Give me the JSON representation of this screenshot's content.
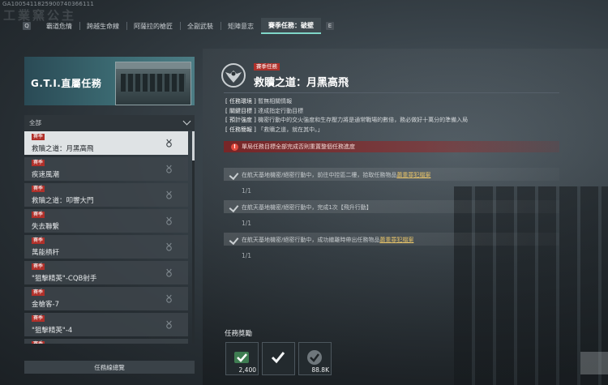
{
  "watermark": "GA1005411825900740366111",
  "ghost_title": "工業窯公主",
  "tabs": {
    "left_key": "Q",
    "right_key": "E",
    "items": [
      {
        "label": "霸道危情",
        "active": false
      },
      {
        "label": "跨越生命線",
        "active": false
      },
      {
        "label": "阿薩拉的槍匠",
        "active": false
      },
      {
        "label": "全副武裝",
        "active": false
      },
      {
        "label": "矩陣意志",
        "active": false
      },
      {
        "label": "賽季任務：破壁",
        "active": true
      }
    ]
  },
  "left_panel": {
    "banner_title": "G.T.I.直屬任務",
    "filter_label": "全部",
    "missions": [
      {
        "tag": "賽季",
        "name": "救贖之道：月黑高飛",
        "selected": true
      },
      {
        "tag": "賽季",
        "name": "疾速風潮",
        "selected": false
      },
      {
        "tag": "賽季",
        "name": "救贖之道：叩響大門",
        "selected": false
      },
      {
        "tag": "賽季",
        "name": "失去聯繫",
        "selected": false
      },
      {
        "tag": "賽季",
        "name": "萬能槓杆",
        "selected": false
      },
      {
        "tag": "賽季",
        "name": "\"狙擊精英\"-CQB射手",
        "selected": false
      },
      {
        "tag": "賽季",
        "name": "金槍客-7",
        "selected": false
      },
      {
        "tag": "賽季",
        "name": "\"狙擊精英\"-4",
        "selected": false
      },
      {
        "tag": "賽季",
        "name": "",
        "selected": false
      }
    ],
    "overview_button": "任務線總覽"
  },
  "detail": {
    "season_tag": "賽季任務",
    "title": "救贖之道：月黑高飛",
    "info": [
      {
        "k": "[ 任務環境 ]",
        "v": "暫無相關情報"
      },
      {
        "k": "[ 關鍵目標 ]",
        "v": "達成指定行動目標"
      },
      {
        "k": "[ 預計強度 ]",
        "v": "機密行動中的交火強度和生存壓力將是通常戰場的數倍，務必做好十萬分的準備入局"
      },
      {
        "k": "[ 任務簡報 ]",
        "v": "「救贖之道，就在其中。」"
      }
    ],
    "warning": "單局任務目標全部完成否則重置整個任務進度",
    "objectives": [
      {
        "pre": "在航天基地機密/絕密行動中，前往中控區二樓，拾取任務物品",
        "item": "蕭重罪犯檔案",
        "post": "",
        "progress": "1/1"
      },
      {
        "pre": "在航天基地機密/絕密行動中，完成1次【飛升行動】",
        "item": "",
        "post": "",
        "progress": "1/1"
      },
      {
        "pre": "在航天基地機密/絕密行動中，成功撤離時帶出任務物品",
        "item": "蕭重罪犯檔案",
        "post": "",
        "progress": "1/1"
      }
    ]
  },
  "rewards": {
    "label": "任務獎勵",
    "items": [
      {
        "icon": "green-check-badge-icon",
        "qty": "2,400"
      },
      {
        "icon": "white-check-badge-icon",
        "qty": ""
      },
      {
        "icon": "grey-check-coin-icon",
        "qty": "88.8K"
      }
    ]
  }
}
